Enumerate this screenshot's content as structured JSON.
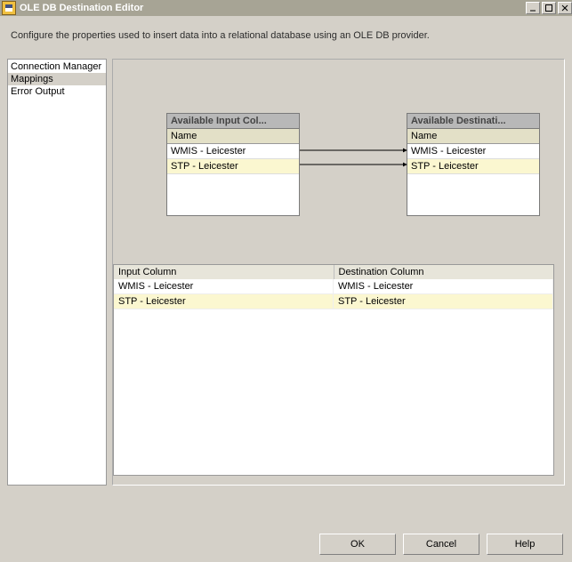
{
  "window": {
    "title": "OLE DB Destination Editor"
  },
  "description": "Configure the properties used to insert data into a relational database using an OLE DB provider.",
  "nav": {
    "items": [
      "Connection Manager",
      "Mappings",
      "Error Output"
    ],
    "selected_index": 1
  },
  "mapping": {
    "source_box": {
      "title": "Available Input Col...",
      "header": "Name",
      "rows": [
        "WMIS - Leicester",
        "STP - Leicester"
      ]
    },
    "target_box": {
      "title": "Available Destinati...",
      "header": "Name",
      "rows": [
        "WMIS - Leicester",
        "STP - Leicester"
      ]
    }
  },
  "grid": {
    "columns": [
      "Input Column",
      "Destination Column"
    ],
    "rows": [
      [
        "WMIS - Leicester",
        "WMIS - Leicester"
      ],
      [
        "STP - Leicester",
        "STP - Leicester"
      ]
    ]
  },
  "buttons": {
    "ok": "OK",
    "cancel": "Cancel",
    "help": "Help"
  }
}
